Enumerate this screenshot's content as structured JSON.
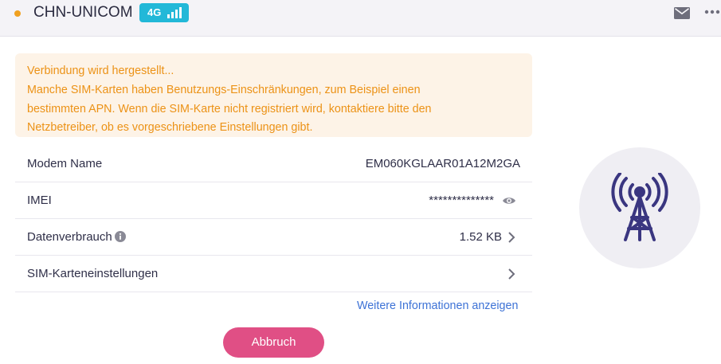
{
  "header": {
    "carrier": "CHN-UNICOM",
    "network_type": "4G",
    "status_color": "#f0a020",
    "badge_color": "#22b8d8",
    "icons": [
      "signal-bars-icon",
      "mail-icon",
      "more-options-icon"
    ]
  },
  "warning": {
    "line1": "Verbindung wird hergestellt...",
    "line2": "Manche SIM-Karten haben Benutzungs-Einschränkungen, zum Beispiel einen",
    "line3": "bestimmten APN. Wenn die SIM-Karte nicht registriert wird, kontaktiere bitte den",
    "line4": "Netzbetreiber, ob es vorgeschriebene Einstellungen gibt.",
    "color": "#ec9216"
  },
  "details": {
    "modem": {
      "label": "Modem Name",
      "value": "EM060KGLAAR01A12M2GA"
    },
    "imei": {
      "label": "IMEI",
      "value": "**************",
      "icon": "eye-icon"
    },
    "data_usage": {
      "label": "Datenverbrauch",
      "value": "1.52 KB",
      "icon": "chevron-right-icon",
      "info_icon": "info-icon"
    },
    "sim_settings": {
      "label": "SIM-Karteneinstellungen",
      "icon": "chevron-right-icon"
    }
  },
  "more_info_link": "Weitere Informationen anzeigen",
  "cancel_button": "Abbruch",
  "accent_color": "#e04f85",
  "illustration_icon": "cell-tower-icon"
}
